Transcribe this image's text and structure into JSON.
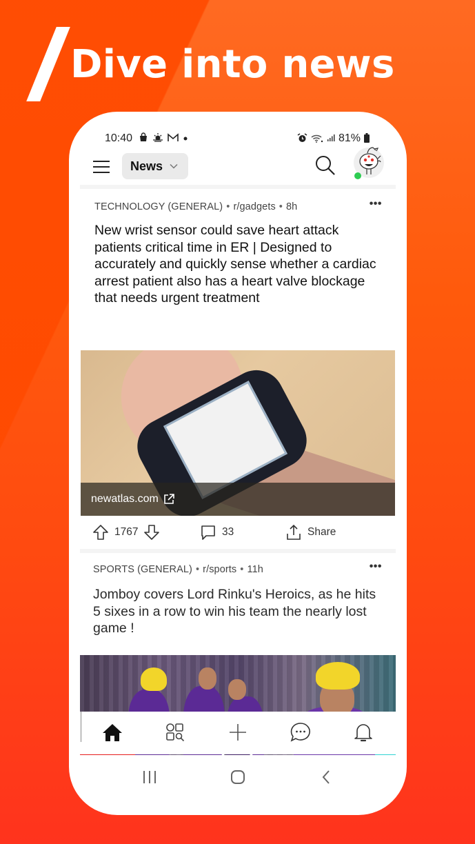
{
  "promo": {
    "headline": "Dive into news",
    "colors": {
      "background_top": "#ff6a22",
      "background_bottom": "#ff331d",
      "band": "#ff4a00"
    }
  },
  "status_bar": {
    "time": "10:40",
    "left_icons": [
      "shopping-bag-icon",
      "weather-icon",
      "gmail-icon",
      "notification-dot-icon"
    ],
    "right_icons": [
      "alarm-icon",
      "wifi-icon",
      "signal-icon"
    ],
    "battery": "81%"
  },
  "top_bar": {
    "menu_icon": "hamburger-menu-icon",
    "feed_selector": {
      "label": "News",
      "icon": "chevron-down-icon"
    },
    "search_icon": "search-icon",
    "avatar": {
      "icon": "snoo-avatar-icon",
      "online": true,
      "online_color": "#2ecc52"
    }
  },
  "posts": [
    {
      "category": "TECHNOLOGY (GENERAL)",
      "subreddit": "r/gadgets",
      "age": "8h",
      "menu_label": "•••",
      "title": "New wrist sensor could save heart attack patients critical time in ER | Designed to accurately and quickly sense whether a cardiac arrest patient also has a heart valve blockage that needs urgent treatment",
      "link_domain": "newatlas.com",
      "votes": "1767",
      "comments": "33",
      "share_label": "Share"
    },
    {
      "category": "SPORTS (GENERAL)",
      "subreddit": "r/sports",
      "age": "11h",
      "menu_label": "•••",
      "title": "Jomboy covers Lord Rinku's Heroics, as he hits 5 sixes in a row to win his team the nearly lost game !",
      "media": "video"
    }
  ],
  "meta_separator": "•",
  "bottom_nav": [
    {
      "name": "home",
      "icon": "home-icon",
      "active": true
    },
    {
      "name": "communities",
      "icon": "communities-icon",
      "active": false
    },
    {
      "name": "create",
      "icon": "plus-icon",
      "active": false
    },
    {
      "name": "chat",
      "icon": "chat-icon",
      "active": false
    },
    {
      "name": "inbox",
      "icon": "bell-icon",
      "active": false
    }
  ],
  "system_nav": [
    "recent-apps-icon",
    "home-circle-icon",
    "back-icon"
  ]
}
